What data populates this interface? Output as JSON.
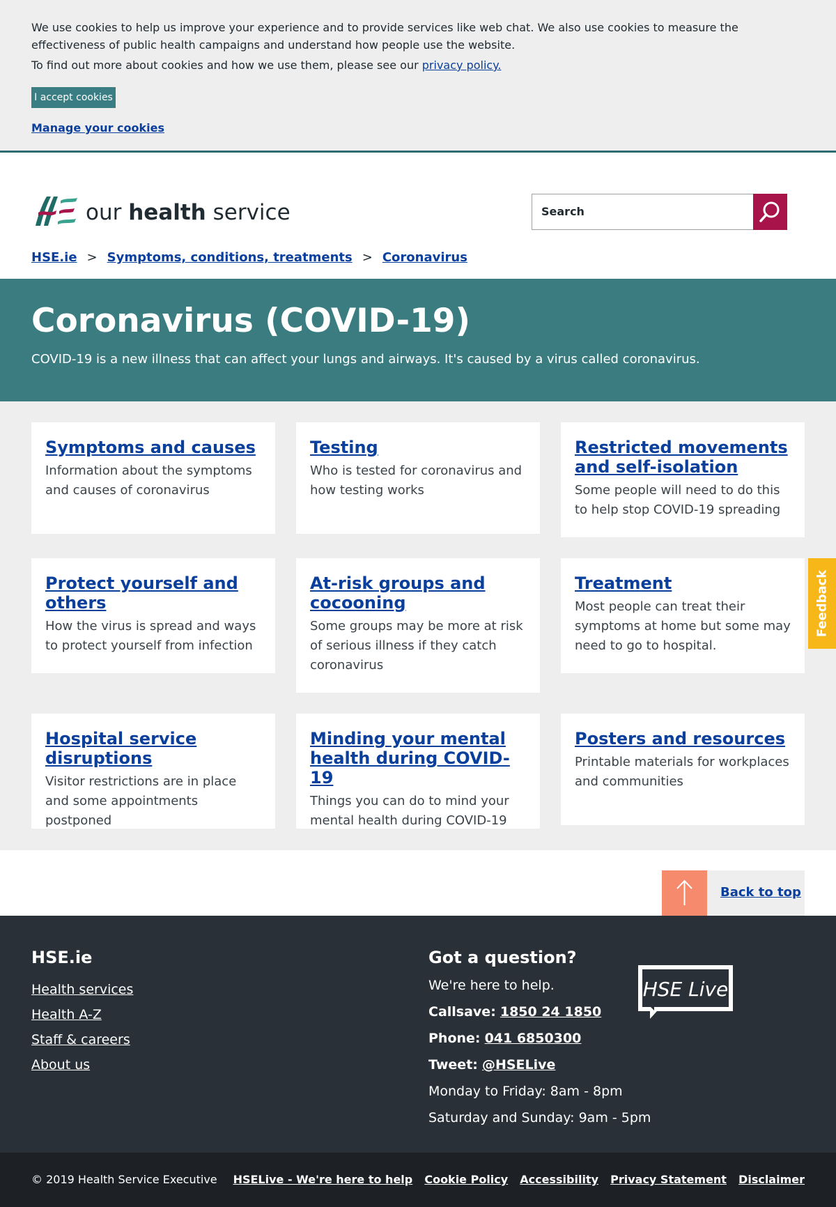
{
  "cookie_banner": {
    "text1": "We use cookies to help us improve your experience and to provide services like web chat. We also use cookies to measure the effectiveness of public health campaigns and understand how people use the website.",
    "text2_prefix": "To find out more about cookies and how we use them, please see our ",
    "privacy_link": "privacy policy.",
    "accept_label": "I accept cookies",
    "manage_label": "Manage your cookies"
  },
  "header": {
    "brand_prefix": "our ",
    "brand_bold": "health",
    "brand_suffix": " service",
    "search_placeholder": "Search"
  },
  "breadcrumb": {
    "items": [
      "HSE.ie",
      "Symptoms, conditions, treatments",
      "Coronavirus"
    ],
    "separator": ">"
  },
  "hero": {
    "title": "Coronavirus (COVID-19)",
    "intro": "COVID-19 is a new illness that can affect your lungs and airways. It's caused by a virus called coronavirus."
  },
  "cards": [
    {
      "title": "Symptoms and causes",
      "desc": "Information about the symptoms and causes of coronavirus"
    },
    {
      "title": "Testing",
      "desc": "Who is tested for coronavirus and how testing works"
    },
    {
      "title": "Restricted movements and self-isolation",
      "desc": "Some people will need to do this to help stop COVID-19 spreading"
    },
    {
      "title": "Protect yourself and others",
      "desc": "How the virus is spread and ways to protect yourself from infection"
    },
    {
      "title": "At-risk groups and cocooning",
      "desc": "Some groups may be more at risk of serious illness if they catch coronavirus"
    },
    {
      "title": "Treatment",
      "desc": "Most people can treat their symptoms at home but some may need to go to hospital."
    },
    {
      "title": "Hospital service disruptions",
      "desc": "Visitor restrictions are in place and some appointments postponed"
    },
    {
      "title": "Minding your mental health during COVID-19",
      "desc": "Things you can do to mind your mental health during COVID-19"
    },
    {
      "title": "Posters and resources",
      "desc": "Printable materials for workplaces and communities"
    }
  ],
  "feedback_label": "Feedback",
  "back_to_top_label": "Back to top",
  "footer": {
    "site_title": "HSE.ie",
    "links": [
      "Health services",
      "Health A-Z",
      "Staff & careers",
      "About us"
    ],
    "question_title": "Got a question?",
    "help_text": "We're here to help.",
    "callsave_label": "Callsave:",
    "callsave_number": "1850 24 1850",
    "phone_label": "Phone:",
    "phone_number": "041 6850300",
    "tweet_label": "Tweet:",
    "tweet_handle": "@HSELive",
    "hours_weekday": "Monday to Friday: 8am - 8pm",
    "hours_weekend": "Saturday and Sunday: 9am - 5pm",
    "hselive_logo_text": "HSE Live"
  },
  "bottom_bar": {
    "copyright": "© 2019 Health Service Executive",
    "links": [
      "HSELive - We're here to help",
      "Cookie Policy",
      "Accessibility",
      "Privacy Statement",
      "Disclaimer"
    ]
  },
  "colors": {
    "teal": "#3a7c80",
    "link": "#0b3f9c",
    "search_button": "#a8134a",
    "feedback": "#f7b718",
    "back_to_top_arrow": "#f58a6c",
    "footer_bg": "#2a3037"
  }
}
